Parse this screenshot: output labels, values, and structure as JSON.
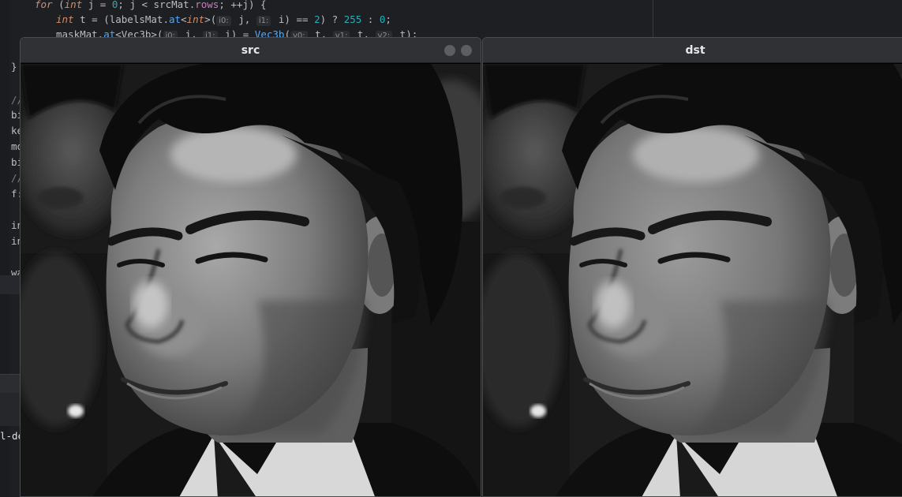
{
  "editor": {
    "code": {
      "line1": {
        "for": "for",
        "open": " (",
        "int": "int",
        "rest": " j = ",
        "zero": "0",
        "mid": "; j < srcMat.",
        "rows": "rows",
        "end": "; ++j) {"
      },
      "line2": {
        "int": "int",
        "t1": " t = (labelsMat.",
        "at": "at",
        "lt": "<",
        "int2": "int",
        "gt": ">(",
        "hint_i0": "i0:",
        "j": " j, ",
        "hint_i1": "i1:",
        "i": " i) == ",
        "two": "2",
        "q": ") ? ",
        "n255": "255",
        "colon": " : ",
        "n0": "0",
        "semi": ";"
      },
      "line3": {
        "a": "maskMat.",
        "at": "at",
        "b": "<Vec3b>(",
        "hint_i0": "i0:",
        "j": " j, ",
        "hint_i1": "i1:",
        "i": " i) = ",
        "vec": "Vec3b",
        "c": "(",
        "hint_v0": "v0:",
        "t1": " t, ",
        "hint_v1": "v1:",
        "t2": " t, ",
        "hint_v2": "v2:",
        "t3": " t);"
      },
      "closing_brace": "}",
      "fragments": [
        "//",
        "bi",
        "ke",
        "mo",
        "bi",
        "//",
        "f:",
        "in",
        "in",
        "wa"
      ]
    },
    "terminal_fragment": "l-de"
  },
  "windows": {
    "src": {
      "title": "src"
    },
    "dst": {
      "title": "dst"
    }
  },
  "colors": {
    "keyword": "#cf8e6d",
    "field": "#c77dbb",
    "number": "#2aacb8",
    "function": "#56a8f5",
    "titlebar": "#303134"
  },
  "icons": {
    "src_minimize": "window-minimize-icon",
    "src_close": "window-close-icon"
  }
}
